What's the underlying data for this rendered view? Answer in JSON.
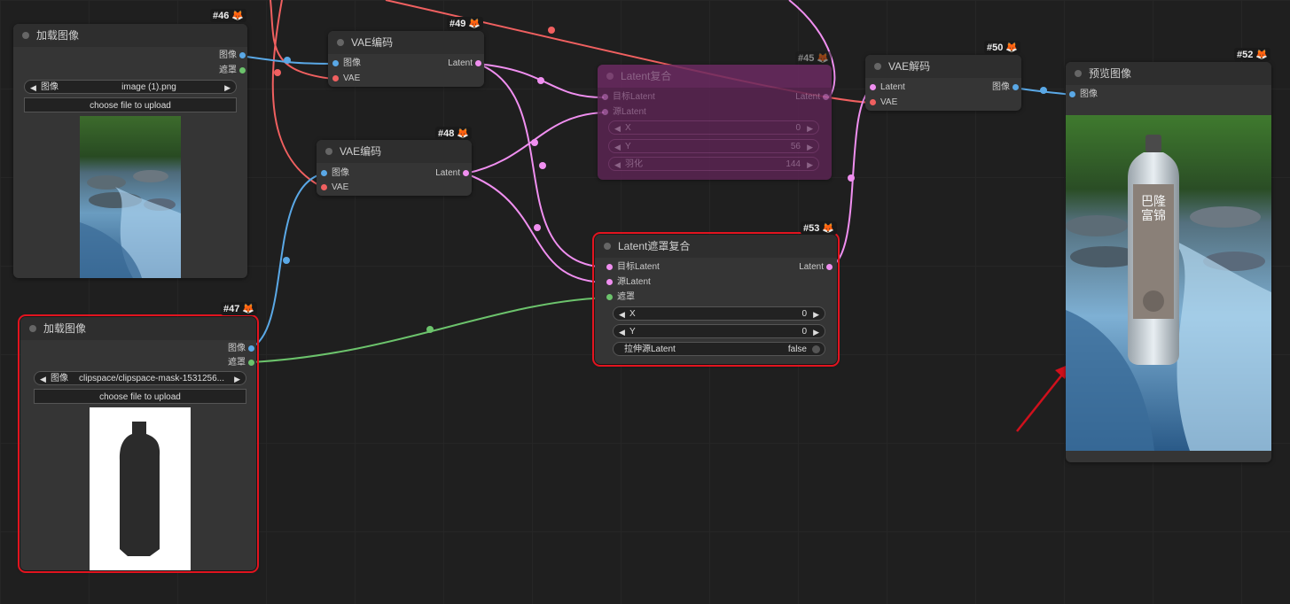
{
  "nodes": {
    "n46": {
      "id": "#46",
      "title": "加载图像",
      "out_image": "图像",
      "out_mask": "遮罩",
      "combo_key": "图像",
      "combo_val": "image (1).png",
      "upload": "choose file to upload"
    },
    "n47": {
      "id": "#47",
      "title": "加载图像",
      "out_image": "图像",
      "out_mask": "遮罩",
      "combo_key": "图像",
      "combo_val": "clipspace/clipspace-mask-1531256...",
      "upload": "choose file to upload"
    },
    "n49": {
      "id": "#49",
      "title": "VAE编码",
      "in_image": "图像",
      "in_vae": "VAE",
      "out_latent": "Latent"
    },
    "n48": {
      "id": "#48",
      "title": "VAE编码",
      "in_image": "图像",
      "in_vae": "VAE",
      "out_latent": "Latent"
    },
    "n45": {
      "id": "#45",
      "title": "Latent复合",
      "in_target": "目标Latent",
      "in_source": "源Latent",
      "out_latent": "Latent",
      "w_x": "X",
      "w_x_val": "0",
      "w_y": "Y",
      "w_y_val": "56",
      "w_f": "羽化",
      "w_f_val": "144"
    },
    "n53": {
      "id": "#53",
      "title": "Latent遮罩复合",
      "in_target": "目标Latent",
      "in_source": "源Latent",
      "in_mask": "遮罩",
      "out_latent": "Latent",
      "w_x": "X",
      "w_x_val": "0",
      "w_y": "Y",
      "w_y_val": "0",
      "w_resize": "拉伸源Latent",
      "w_resize_val": "false"
    },
    "n50": {
      "id": "#50",
      "title": "VAE解码",
      "in_latent": "Latent",
      "in_vae": "VAE",
      "out_image": "图像"
    },
    "n52": {
      "id": "#52",
      "title": "预览图像",
      "in_image": "图像"
    }
  },
  "colors": {
    "image": "#5aa8e6",
    "latent": "#f08ff0",
    "vae": "#f06060",
    "mask": "#6cc36c",
    "selected": "#e2141f",
    "arrow": "#d0101c"
  },
  "bottle_label": {
    "line1": "巴隆",
    "line2": "富锦"
  }
}
